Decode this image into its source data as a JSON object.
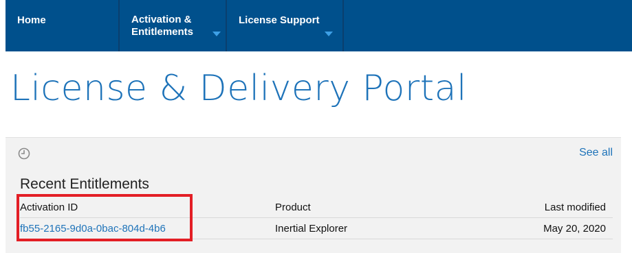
{
  "nav": {
    "home": "Home",
    "activation_line1": "Activation &",
    "activation_line2": "Entitlements",
    "license_support": "License Support"
  },
  "page_title": "License & Delivery Portal",
  "recent": {
    "icon": "clock-icon",
    "see_all": "See all",
    "title": "Recent Entitlements",
    "columns": [
      "Activation ID",
      "Product",
      "Last modified"
    ],
    "rows": [
      [
        "fb55-2165-9d0a-0bac-804d-4b6",
        "Inertial Explorer",
        "May 20, 2020"
      ]
    ]
  },
  "colors": {
    "nav_bg": "#00508c",
    "accent": "#1e73b9",
    "highlight": "#e31e25"
  }
}
